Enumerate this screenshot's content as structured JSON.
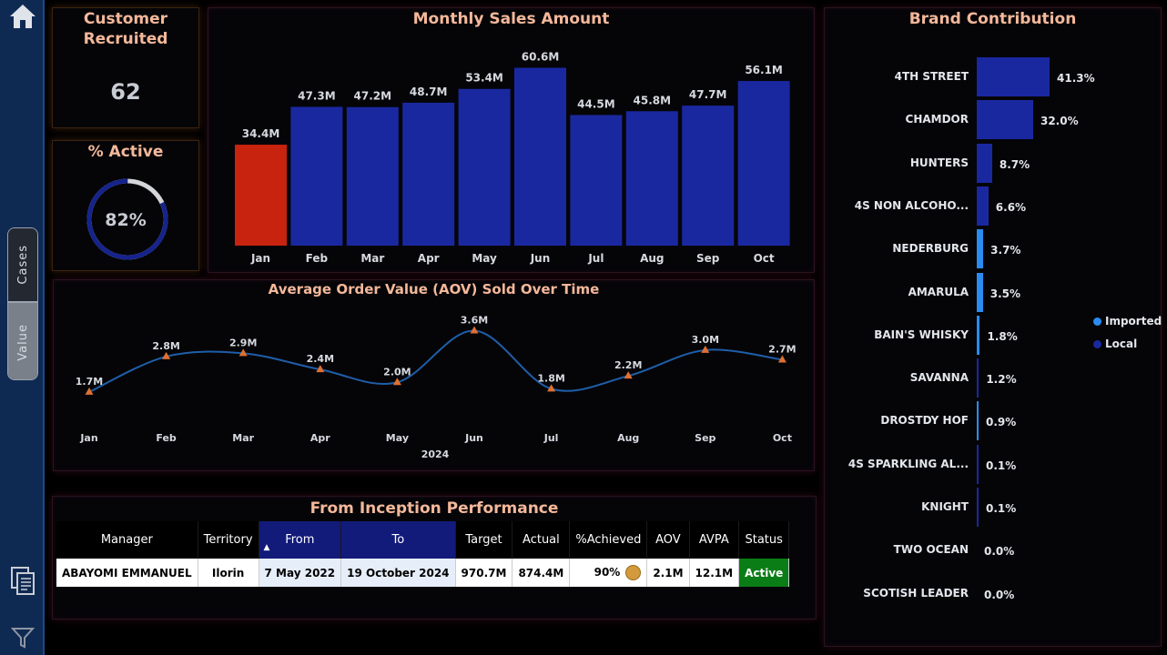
{
  "nav": {
    "toggle": {
      "cases_label": "Cases",
      "value_label": "Value",
      "selected": "Value"
    },
    "icons": [
      "home-icon",
      "documents-icon",
      "filter-icon"
    ]
  },
  "kpis": {
    "customer_recruited": {
      "title_line1": "Customer",
      "title_line2": "Recruited",
      "value": "62"
    },
    "active": {
      "title": "% Active",
      "value": "82%",
      "fraction": 0.82
    }
  },
  "monthly_sales": {
    "title": "Monthly Sales Amount",
    "chart_data": {
      "type": "bar",
      "categories": [
        "Jan",
        "Feb",
        "Mar",
        "Apr",
        "May",
        "Jun",
        "Jul",
        "Aug",
        "Sep",
        "Oct"
      ],
      "values": [
        34.4,
        47.3,
        47.2,
        48.7,
        53.4,
        60.6,
        44.5,
        45.8,
        47.7,
        56.1
      ],
      "labels": [
        "34.4M",
        "47.3M",
        "47.2M",
        "48.7M",
        "53.4M",
        "60.6M",
        "44.5M",
        "45.8M",
        "47.7M",
        "56.1M"
      ],
      "highlight_index": 0,
      "ylim": [
        0,
        62
      ],
      "colors": {
        "bar": "#1a28a0",
        "highlight": "#c8230f"
      }
    }
  },
  "aov": {
    "title": "Average Order Value (AOV) Sold Over Time",
    "chart_data": {
      "type": "line",
      "categories": [
        "Jan",
        "Feb",
        "Mar",
        "Apr",
        "May",
        "Jun",
        "Jul",
        "Aug",
        "Sep",
        "Oct"
      ],
      "values": [
        1.7,
        2.8,
        2.9,
        2.4,
        2.0,
        3.6,
        1.8,
        2.2,
        3.0,
        2.7
      ],
      "labels": [
        "1.7M",
        "2.8M",
        "2.9M",
        "2.4M",
        "2.0M",
        "3.6M",
        "1.8M",
        "2.2M",
        "3.0M",
        "2.7M"
      ],
      "xlabel": "2024",
      "ylim": [
        1.5,
        3.7
      ],
      "colors": {
        "line": "#1f5ea8",
        "marker": "#e07030"
      }
    }
  },
  "brand": {
    "title": "Brand Contribution",
    "legend": [
      {
        "label": "Imported",
        "color": "#2a8cf0"
      },
      {
        "label": "Local",
        "color": "#1a28a0"
      }
    ],
    "chart_data": {
      "type": "bar",
      "orientation": "horizontal",
      "categories": [
        "4TH STREET",
        "CHAMDOR",
        "HUNTERS",
        "4S NON ALCOHO...",
        "NEDERBURG",
        "AMARULA",
        "BAIN'S WHISKY",
        "SAVANNA",
        "DROSTDY HOF",
        "4S SPARKLING AL...",
        "KNIGHT",
        "TWO OCEAN",
        "SCOTISH LEADER"
      ],
      "values": [
        41.3,
        32.0,
        8.7,
        6.6,
        3.7,
        3.5,
        1.8,
        1.2,
        0.9,
        0.1,
        0.1,
        0.0,
        0.0
      ],
      "labels": [
        "41.3%",
        "32.0%",
        "8.7%",
        "6.6%",
        "3.7%",
        "3.5%",
        "1.8%",
        "1.2%",
        "0.9%",
        "0.1%",
        "0.1%",
        "0.0%",
        "0.0%"
      ],
      "series_type": [
        "Local",
        "Local",
        "Local",
        "Local",
        "Imported",
        "Imported",
        "Imported",
        "Local",
        "Imported",
        "Local",
        "Local",
        "Imported",
        "Imported"
      ],
      "xlim": [
        0,
        41.3
      ]
    }
  },
  "inception": {
    "title": "From Inception Performance",
    "columns": [
      "Manager",
      "Territory",
      "From",
      "To",
      "Target",
      "Actual",
      "%Achieved",
      "AOV",
      "AVPA",
      "Status"
    ],
    "sorted_column": "From",
    "rows": [
      {
        "manager": "ABAYOMI EMMANUEL",
        "territory": "Ilorin",
        "from": "7 May 2022",
        "to": "19 October 2024",
        "target": "970.7M",
        "actual": "874.4M",
        "achieved": "90%",
        "aov": "2.1M",
        "avpa": "12.1M",
        "status": "Active"
      }
    ]
  }
}
